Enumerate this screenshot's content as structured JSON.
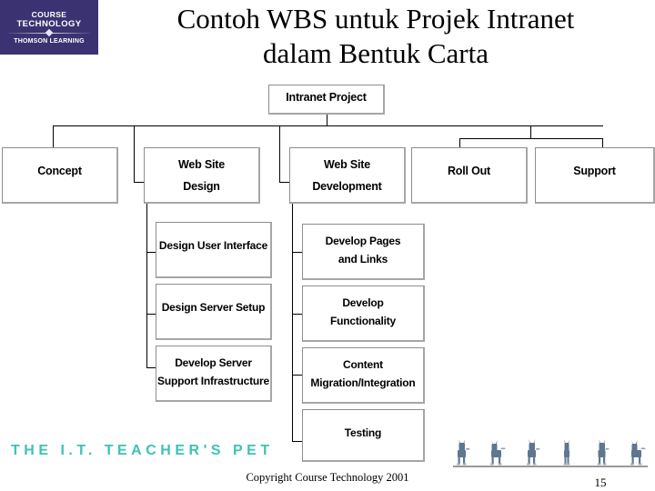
{
  "logo": {
    "line1": "COURSE",
    "line2": "TECHNOLOGY",
    "line3": "THOMSON LEARNING",
    "bg_color": "#3b3272"
  },
  "title": {
    "line1": "Contoh WBS untuk Projek Intranet",
    "line2": "dalam Bentuk Carta"
  },
  "footer": {
    "brand": "THE I.T. TEACHER'S PET",
    "brand_color": "#3fc2b4",
    "copyright": "Copyright Course Technology 2001",
    "page_number": "15",
    "dog_count": 6
  },
  "chart_data": {
    "type": "diagram",
    "title": "Contoh WBS untuk Projek Intranet dalam Bentuk Carta",
    "root": "Intranet Project",
    "levels": 3,
    "nodes": {
      "root": "Intranet Project",
      "level2": [
        "Concept",
        "Web Site Design",
        "Web Site Development",
        "Roll Out",
        "Support"
      ],
      "level3_web_site_design": [
        "Design User Interface",
        "Design Server Setup",
        "Develop Server Support Infrastructure"
      ],
      "level3_web_site_development": [
        "Develop Pages and Links",
        "Develop Functionality",
        "Content Migration/Integration",
        "Testing"
      ]
    }
  },
  "nodes": {
    "root": "Intranet Project",
    "concept": "Concept",
    "web_site_design": "Web Site\nDesign",
    "web_site_design_l1": "Web Site",
    "web_site_design_l2": "Design",
    "web_site_development_l1": "Web Site",
    "web_site_development_l2": "Development",
    "roll_out": "Roll Out",
    "support": "Support",
    "design_user_interface": "Design User Interface",
    "design_server_setup": "Design Server Setup",
    "develop_server_support_l1": "Develop Server",
    "develop_server_support_l2": "Support Infrastructure",
    "develop_pages_l1": "Develop Pages",
    "develop_pages_l2": "and Links",
    "develop_functionality_l1": "Develop",
    "develop_functionality_l2": "Functionality",
    "content_migration_l1": "Content",
    "content_migration_l2": "Migration/Integration",
    "testing": "Testing"
  }
}
